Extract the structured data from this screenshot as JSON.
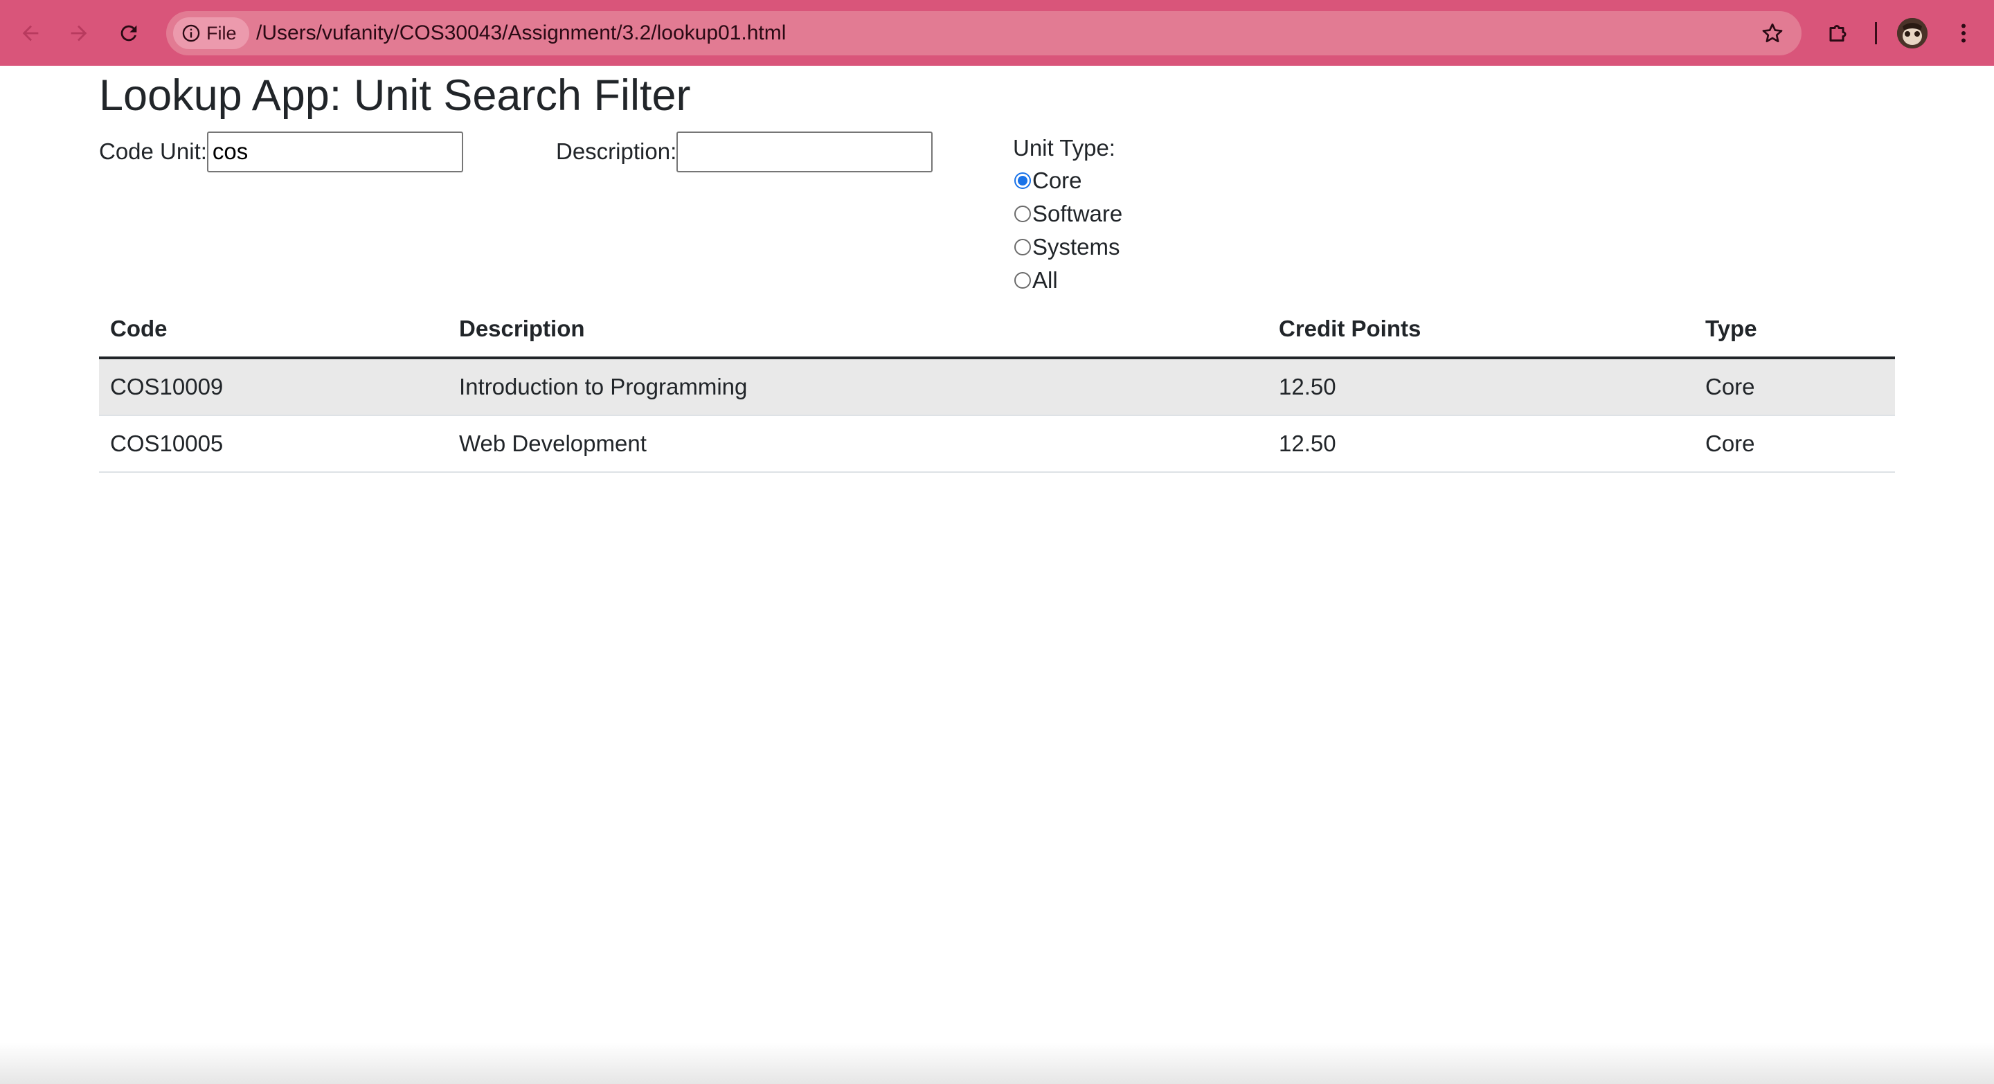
{
  "browser": {
    "file_chip_label": "File",
    "url": "/Users/vufanity/COS30043/Assignment/3.2/lookup01.html",
    "icons": {
      "back": "arrow-left",
      "forward": "arrow-right",
      "reload": "reload",
      "info": "info-circle",
      "bookmark": "star",
      "extensions": "puzzle-piece",
      "profile": "avatar",
      "menu": "kebab"
    },
    "accent_color": "#d9557a"
  },
  "page": {
    "title": "Lookup App: Unit Search Filter",
    "filters": {
      "code_label": "Code Unit:",
      "code_value": "cos",
      "description_label": "Description:",
      "description_value": "",
      "type_label": "Unit Type:",
      "type_options": [
        "Core",
        "Software",
        "Systems",
        "All"
      ],
      "type_selected": "Core"
    },
    "table": {
      "headers": [
        "Code",
        "Description",
        "Credit Points",
        "Type"
      ],
      "rows": [
        [
          "COS10009",
          "Introduction to Programming",
          "12.50",
          "Core"
        ],
        [
          "COS10005",
          "Web Development",
          "12.50",
          "Core"
        ]
      ]
    }
  }
}
